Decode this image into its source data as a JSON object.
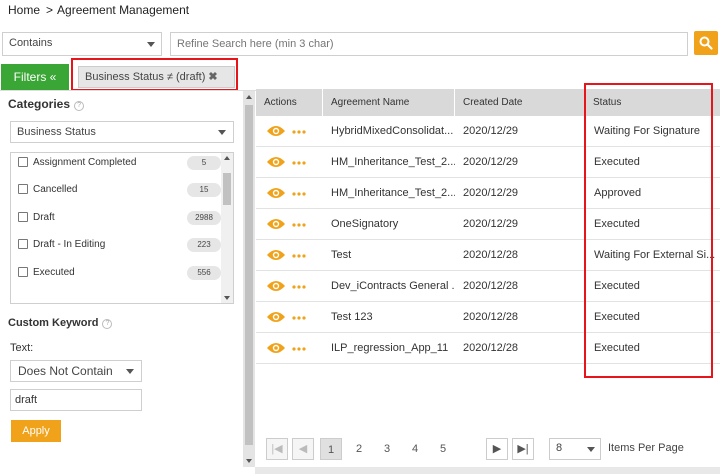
{
  "breadcrumb": {
    "home": "Home",
    "separator": ">",
    "current": "Agreement Management"
  },
  "search": {
    "scope_value": "Contains",
    "placeholder": "Refine Search here (min 3 char)"
  },
  "filters": {
    "toggle_label": "Filters «",
    "active_chip": "Business Status ≠ (draft)",
    "chip_remove": "✖"
  },
  "categories": {
    "title": "Categories",
    "help": "?",
    "selected": "Business Status",
    "items": [
      {
        "label": "Assignment Completed",
        "count": "5"
      },
      {
        "label": "Cancelled",
        "count": "15"
      },
      {
        "label": "Draft",
        "count": "2988"
      },
      {
        "label": "Draft - In Editing",
        "count": "223"
      },
      {
        "label": "Executed",
        "count": "556"
      }
    ]
  },
  "keyword": {
    "title": "Custom Keyword",
    "help": "?",
    "text_label": "Text:",
    "operator": "Does Not Contain",
    "value": "draft",
    "apply_label": "Apply"
  },
  "table": {
    "headers": [
      "Actions",
      "Agreement Name",
      "Created Date",
      "Status"
    ],
    "rows": [
      {
        "name": "HybridMixedConsolidat...",
        "date": "2020/12/29",
        "status": "Waiting For Signature"
      },
      {
        "name": "HM_Inheritance_Test_2...",
        "date": "2020/12/29",
        "status": "Executed"
      },
      {
        "name": "HM_Inheritance_Test_2...",
        "date": "2020/12/29",
        "status": "Approved"
      },
      {
        "name": "OneSignatory",
        "date": "2020/12/29",
        "status": "Executed"
      },
      {
        "name": "Test",
        "date": "2020/12/28",
        "status": "Waiting For External Si..."
      },
      {
        "name": "Dev_iContracts General ...",
        "date": "2020/12/28",
        "status": "Executed"
      },
      {
        "name": "Test 123",
        "date": "2020/12/28",
        "status": "Executed"
      },
      {
        "name": "ILP_regression_App_11",
        "date": "2020/12/28",
        "status": "Executed"
      }
    ]
  },
  "pagination": {
    "first": "|◀",
    "prev": "◀",
    "pages": [
      "1",
      "2",
      "3",
      "4",
      "5"
    ],
    "next": "▶",
    "last": "▶|",
    "per_page": "8",
    "per_page_label": "Items Per Page"
  },
  "colors": {
    "accent": "#f0a31a",
    "filters_green": "#3aa635",
    "highlight_red": "#e8141c"
  },
  "icons": {
    "search": "search-icon",
    "view": "eye-icon",
    "more": "more-dots-icon"
  }
}
